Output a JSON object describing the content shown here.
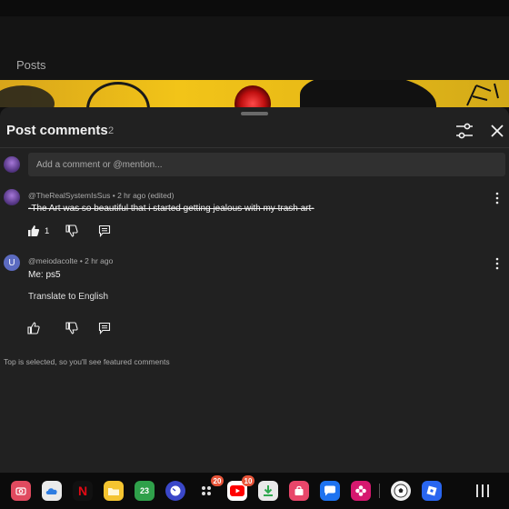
{
  "channel": {
    "tab_label": "Posts"
  },
  "sheet": {
    "title": "Post comments",
    "count": "2",
    "add_comment_placeholder": "Add a comment or @mention..."
  },
  "comments": [
    {
      "author": "@TheRealSystemIsSus",
      "time": "2 hr ago (edited)",
      "text": "-The Art was so beautiful that i started getting jealous with my trash art-",
      "like_count": "1",
      "avatar": "purple-avatar"
    },
    {
      "author": "@meiodacolte",
      "time": "2 hr ago",
      "text": "Me: ps5",
      "translate": "Translate to English",
      "avatar_letter": "U"
    }
  ],
  "footnote": "Top is selected, so you'll see featured comments",
  "taskbar": {
    "apps": [
      {
        "name": "camera",
        "color": "#e04a5f"
      },
      {
        "name": "cloud",
        "color": "#eaeaea"
      },
      {
        "name": "netflix",
        "color": "#111111",
        "label": "N"
      },
      {
        "name": "files",
        "color": "#f4c430"
      },
      {
        "name": "calendar",
        "color": "#2fa04a",
        "label": "23"
      },
      {
        "name": "clock",
        "color": "#3a47c8"
      },
      {
        "name": "app-folder",
        "color": "#4a4a4a",
        "badge": "20"
      },
      {
        "name": "youtube",
        "color": "#ffffff",
        "badge": "10"
      },
      {
        "name": "download",
        "color": "#e9e9e9"
      },
      {
        "name": "store",
        "color": "#e8466a"
      },
      {
        "name": "messages",
        "color": "#1e73f0"
      },
      {
        "name": "flower",
        "color": "#d6186f"
      },
      {
        "name": "soccer-game",
        "color": "#f0f0f0"
      },
      {
        "name": "roblox",
        "color": "#2966f0"
      }
    ]
  }
}
